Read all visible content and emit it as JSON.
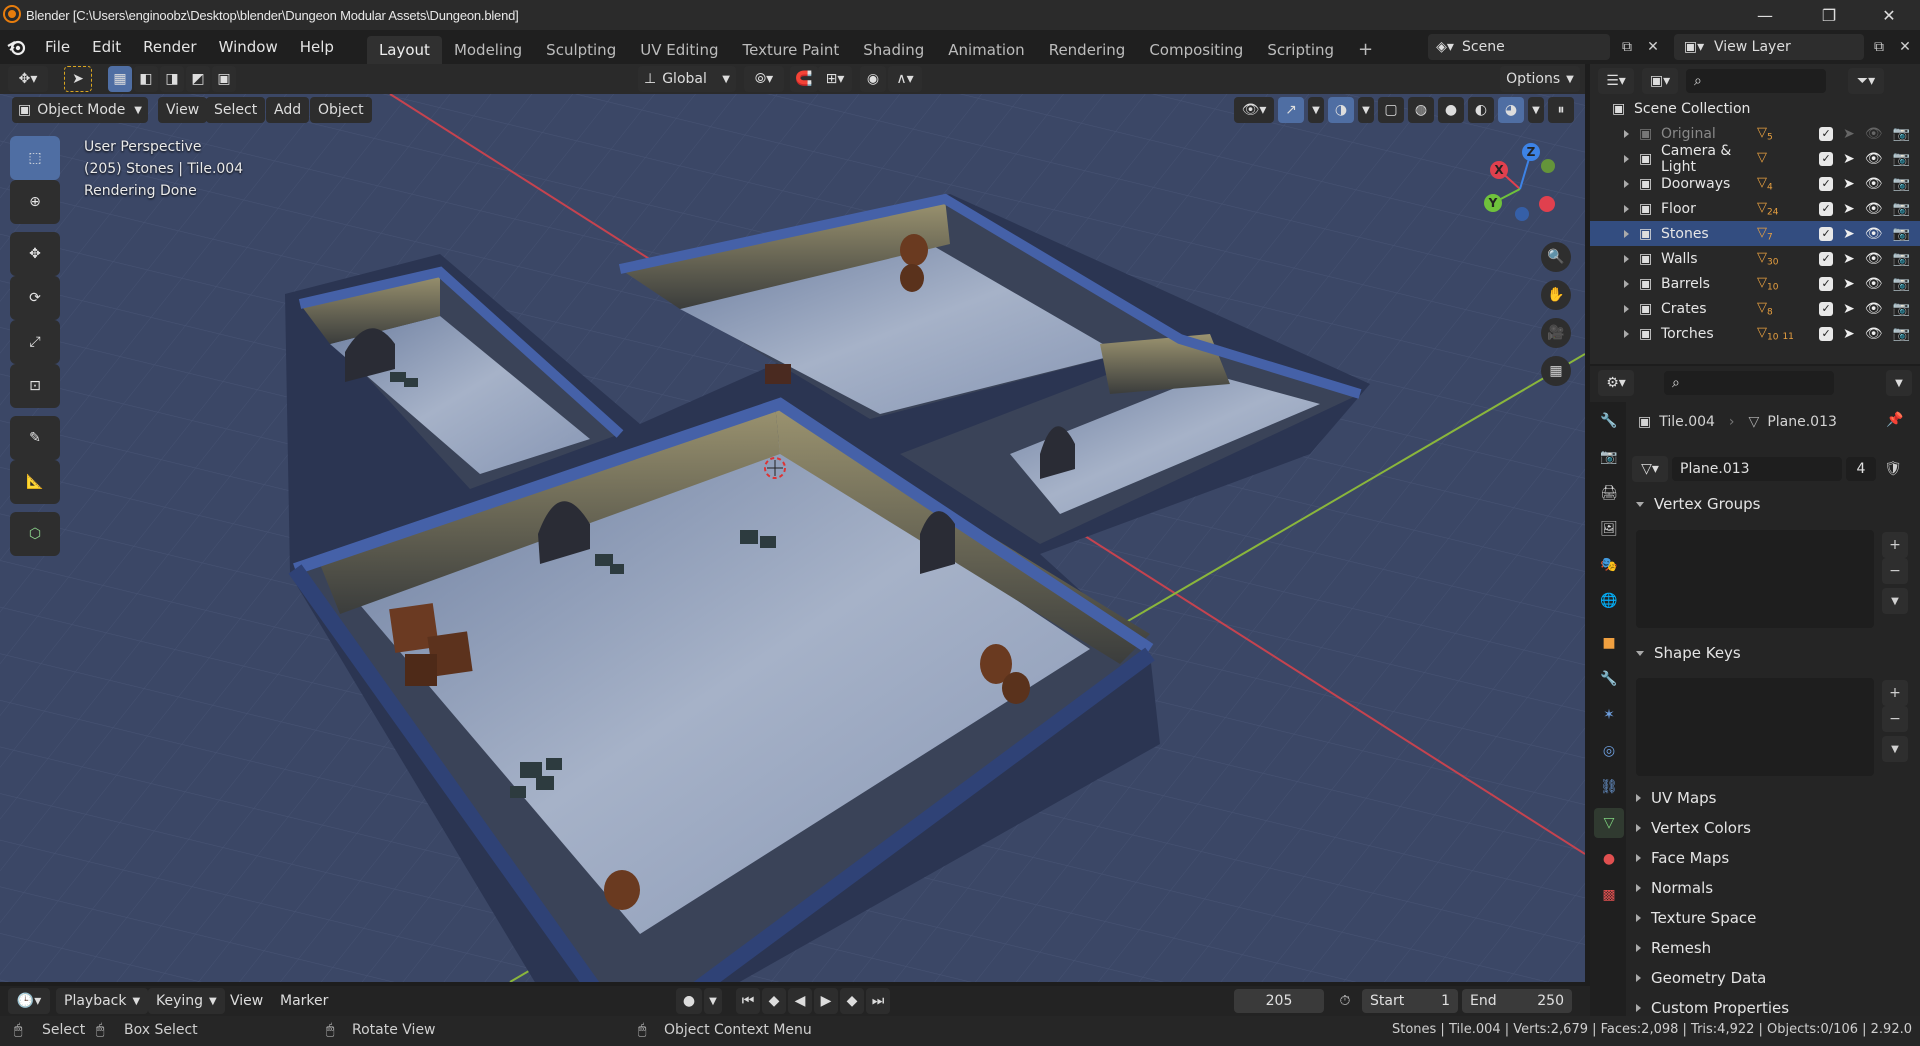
{
  "window": {
    "title": "Blender [C:\\Users\\enginoobz\\Desktop\\blender\\Dungeon Modular Assets\\Dungeon.blend]",
    "minimize": "—",
    "maximize": "❐",
    "close": "✕"
  },
  "menu": {
    "items": [
      "File",
      "Edit",
      "Render",
      "Window",
      "Help"
    ]
  },
  "workspaces": {
    "tabs": [
      "Layout",
      "Modeling",
      "Sculpting",
      "UV Editing",
      "Texture Paint",
      "Shading",
      "Animation",
      "Rendering",
      "Compositing",
      "Scripting"
    ],
    "active": "Layout",
    "add": "+"
  },
  "scene": {
    "name": "Scene",
    "view_layer": "View Layer"
  },
  "viewport_header": {
    "transform_orientation": "Global",
    "options": "Options",
    "mode": "Object Mode",
    "menus": [
      "View",
      "Select",
      "Add",
      "Object"
    ]
  },
  "viewport": {
    "perspective": "User Perspective",
    "object_info": "(205) Stones | Tile.004",
    "render_status": "Rendering Done",
    "axis_x": "X",
    "axis_y": "Y",
    "axis_z": "Z",
    "colors": {
      "axis_x": "#e0404e",
      "axis_y": "#6fc23c",
      "axis_z": "#3d83e6",
      "grid_red": "#c5434f",
      "grid_green": "#8ab63c"
    }
  },
  "outliner": {
    "root": "Scene Collection",
    "collections": [
      {
        "name": "Original",
        "count": "5",
        "dim": true
      },
      {
        "name": "Camera & Light",
        "count": "",
        "dim": false
      },
      {
        "name": "Doorways",
        "count": "4",
        "dim": false
      },
      {
        "name": "Floor",
        "count": "24",
        "dim": false
      },
      {
        "name": "Stones",
        "count": "7",
        "dim": false,
        "selected": true
      },
      {
        "name": "Walls",
        "count": "30",
        "dim": false
      },
      {
        "name": "Barrels",
        "count": "10",
        "dim": false
      },
      {
        "name": "Crates",
        "count": "8",
        "dim": false
      },
      {
        "name": "Torches",
        "count": "10",
        "count2": "11",
        "dim": false
      }
    ]
  },
  "properties": {
    "object": "Tile.004",
    "mesh": "Plane.013",
    "mesh_field": "Plane.013",
    "users": "4",
    "panels": {
      "vertex_groups": "Vertex Groups",
      "shape_keys": "Shape Keys",
      "collapsed": [
        "UV Maps",
        "Vertex Colors",
        "Face Maps",
        "Normals",
        "Texture Space",
        "Remesh",
        "Geometry Data",
        "Custom Properties"
      ]
    }
  },
  "timeline": {
    "menus": [
      "Playback",
      "Keying",
      "View",
      "Marker"
    ],
    "current_frame": "205",
    "start_label": "Start",
    "start": "1",
    "end_label": "End",
    "end": "250"
  },
  "status": {
    "select": "Select",
    "box_select": "Box Select",
    "rotate_view": "Rotate View",
    "context_menu": "Object Context Menu",
    "stats": "Stones | Tile.004 | Verts:2,679 | Faces:2,098 | Tris:4,922 | Objects:0/106 | 2.92.0"
  }
}
